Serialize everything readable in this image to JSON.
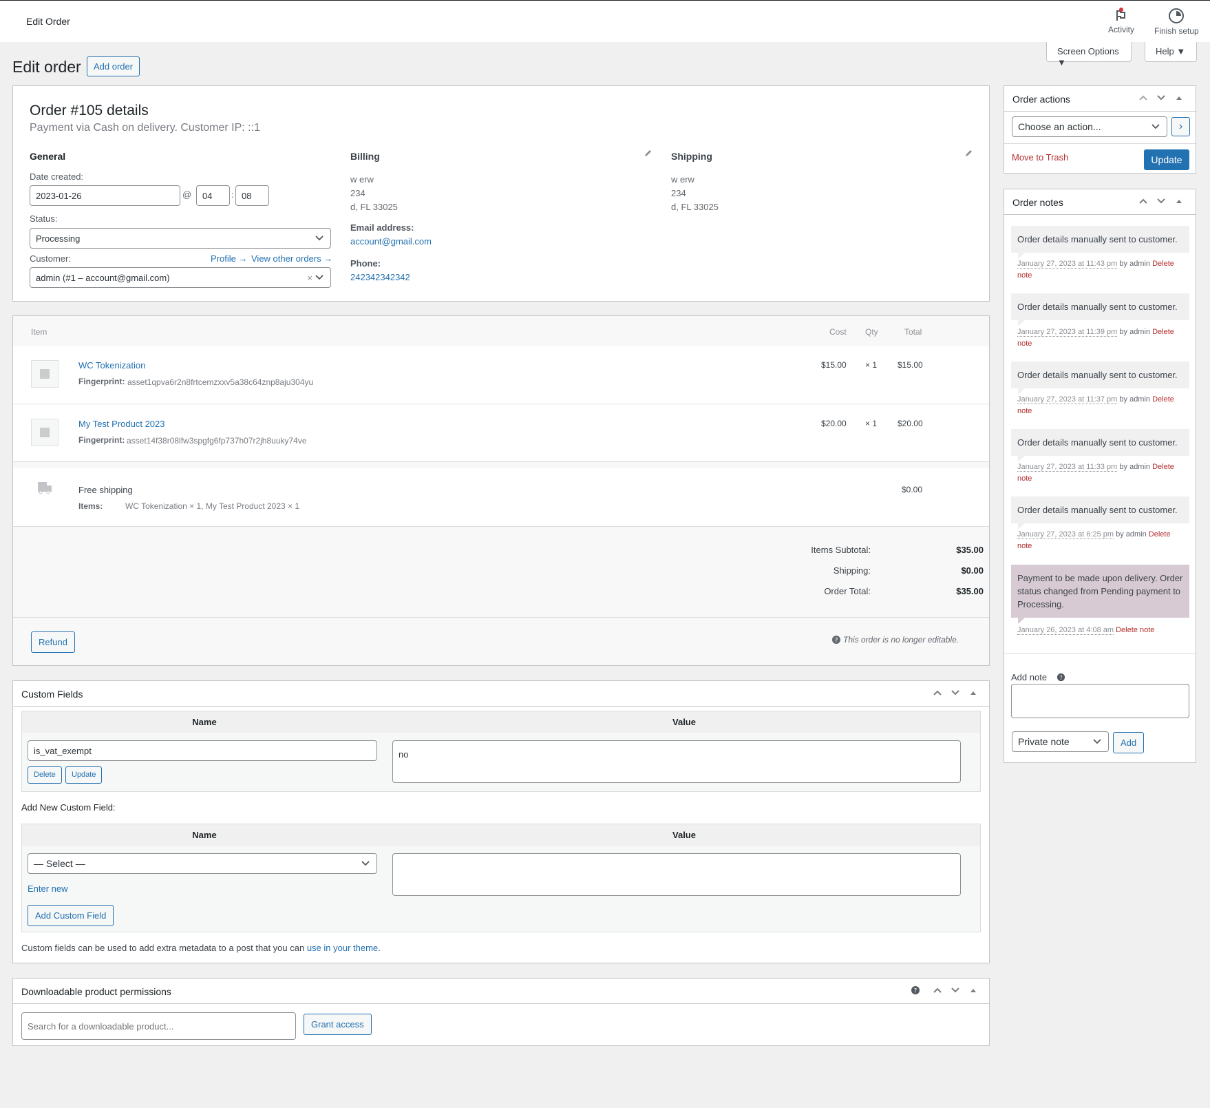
{
  "topbar": {
    "title": "Edit Order",
    "activity": "Activity",
    "finish_setup": "Finish setup"
  },
  "screen_options": "Screen Options ▼",
  "help": "Help ▼",
  "page": {
    "title": "Edit order",
    "add_order": "Add order"
  },
  "order": {
    "title": "Order #105 details",
    "subtitle": "Payment via Cash on delivery. Customer IP: ::1",
    "general": {
      "heading": "General",
      "date_label": "Date created:",
      "date": "2023-01-26",
      "at": "@",
      "hour": "04",
      "colon": ":",
      "minute": "08",
      "status_label": "Status:",
      "status": "Processing",
      "customer_label": "Customer:",
      "profile_link": "Profile →",
      "other_orders_link": "View other orders →",
      "customer": "admin (#1 – account@gmail.com)",
      "clear": "×"
    },
    "billing": {
      "heading": "Billing",
      "lines": [
        "w erw",
        "234",
        "d, FL 33025"
      ],
      "email_label": "Email address:",
      "email": "account@gmail.com",
      "phone_label": "Phone:",
      "phone": "242342342342"
    },
    "shipping": {
      "heading": "Shipping",
      "lines": [
        "w erw",
        "234",
        "d, FL 33025"
      ]
    }
  },
  "items": {
    "headers": {
      "item": "Item",
      "cost": "Cost",
      "qty": "Qty",
      "total": "Total"
    },
    "rows": [
      {
        "name": "WC Tokenization",
        "meta_label": "Fingerprint:",
        "meta_value": "asset1qpva6r2n8frtcemzxxv5a38c64znp8aju304yu",
        "cost": "$15.00",
        "qty": "× 1",
        "total": "$15.00"
      },
      {
        "name": "My Test Product 2023",
        "meta_label": "Fingerprint:",
        "meta_value": "asset14f38r08lfw3spgfg6fp737h07r2jh8uuky74ve",
        "cost": "$20.00",
        "qty": "× 1",
        "total": "$20.00"
      }
    ],
    "shipping": {
      "name": "Free shipping",
      "items_label": "Items:",
      "items_value": "WC Tokenization × 1, My Test Product 2023 × 1",
      "total": "$0.00"
    },
    "totals": [
      {
        "label": "Items Subtotal:",
        "value": "$35.00"
      },
      {
        "label": "Shipping:",
        "value": "$0.00"
      },
      {
        "label": "Order Total:",
        "value": "$35.00"
      }
    ],
    "refund": "Refund",
    "not_editable": "This order is no longer editable."
  },
  "custom_fields": {
    "title": "Custom Fields",
    "name_header": "Name",
    "value_header": "Value",
    "existing": {
      "name": "is_vat_exempt",
      "value": "no",
      "delete": "Delete",
      "update": "Update"
    },
    "add_new_label": "Add New Custom Field:",
    "select_placeholder": "— Select —",
    "enter_new": "Enter new",
    "add_button": "Add Custom Field",
    "footer_text": "Custom fields can be used to add extra metadata to a post that you can ",
    "footer_link": "use in your theme",
    "footer_end": "."
  },
  "downloads": {
    "title": "Downloadable product permissions",
    "search_placeholder": "Search for a downloadable product...",
    "grant": "Grant access"
  },
  "order_actions": {
    "title": "Order actions",
    "select": "Choose an action...",
    "go": "›",
    "trash": "Move to Trash",
    "update": "Update"
  },
  "order_notes": {
    "title": "Order notes",
    "notes": [
      {
        "text": "Order details manually sent to customer.",
        "date": "January 27, 2023 at 11:43 pm",
        "by": " by admin ",
        "del1": "Delete",
        "del2": "note"
      },
      {
        "text": "Order details manually sent to customer.",
        "date": "January 27, 2023 at 11:39 pm",
        "by": " by admin ",
        "del1": "Delete",
        "del2": "note"
      },
      {
        "text": "Order details manually sent to customer.",
        "date": "January 27, 2023 at 11:37 pm",
        "by": " by admin ",
        "del1": "Delete",
        "del2": "note"
      },
      {
        "text": "Order details manually sent to customer.",
        "date": "January 27, 2023 at 11:33 pm",
        "by": " by admin ",
        "del1": "Delete",
        "del2": "note"
      },
      {
        "text": "Order details manually sent to customer.",
        "date": "January 27, 2023 at 6:25 pm",
        "by": " by admin ",
        "del1": "Delete",
        "del2": "note"
      },
      {
        "text": "Payment to be made upon delivery. Order status changed from Pending payment to Processing.",
        "date": "January 26, 2023 at 4:08 am",
        "by": " ",
        "del1": "Delete note",
        "del2": ""
      }
    ],
    "add_note_label": "Add note",
    "note_type": "Private note",
    "add": "Add"
  },
  "colors": {
    "accent": "#2271b1",
    "danger": "#b32d2e",
    "system_note": "#d7cad2"
  }
}
